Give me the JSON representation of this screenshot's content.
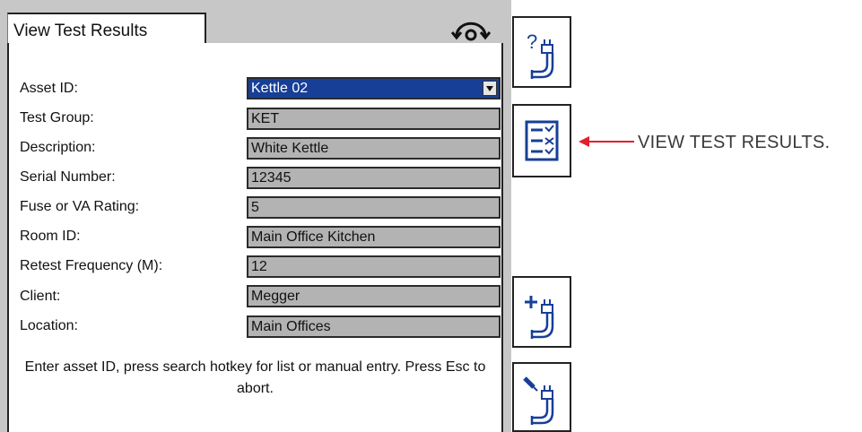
{
  "tab": {
    "title": "View Test Results"
  },
  "form": {
    "fields": [
      {
        "label": "Asset ID:",
        "value": "Kettle 02"
      },
      {
        "label": "Test Group:",
        "value": "KET"
      },
      {
        "label": "Description:",
        "value": "White Kettle"
      },
      {
        "label": "Serial Number:",
        "value": "12345"
      },
      {
        "label": "Fuse or VA Rating:",
        "value": "5"
      },
      {
        "label": "Room ID:",
        "value": "Main Office Kitchen"
      },
      {
        "label": "Retest Frequency (M):",
        "value": "12"
      },
      {
        "label": "Client:",
        "value": "Megger"
      },
      {
        "label": "Location:",
        "value": "Main Offices"
      }
    ],
    "help_text": "Enter asset ID, press search hotkey for list or manual entry. Press Esc to abort."
  },
  "softkeys": [
    {
      "icon": "help-plug-icon"
    },
    {
      "icon": "checklist-icon"
    },
    {
      "icon": "add-plug-icon"
    },
    {
      "icon": "edit-plug-icon"
    }
  ],
  "callout": {
    "text": "VIEW TEST RESULTS.",
    "arrow_color": "#e0202a"
  },
  "colors": {
    "active_field": "#173f97",
    "field_background": "#b3b3b3",
    "device_frame": "#c7c7c7"
  }
}
